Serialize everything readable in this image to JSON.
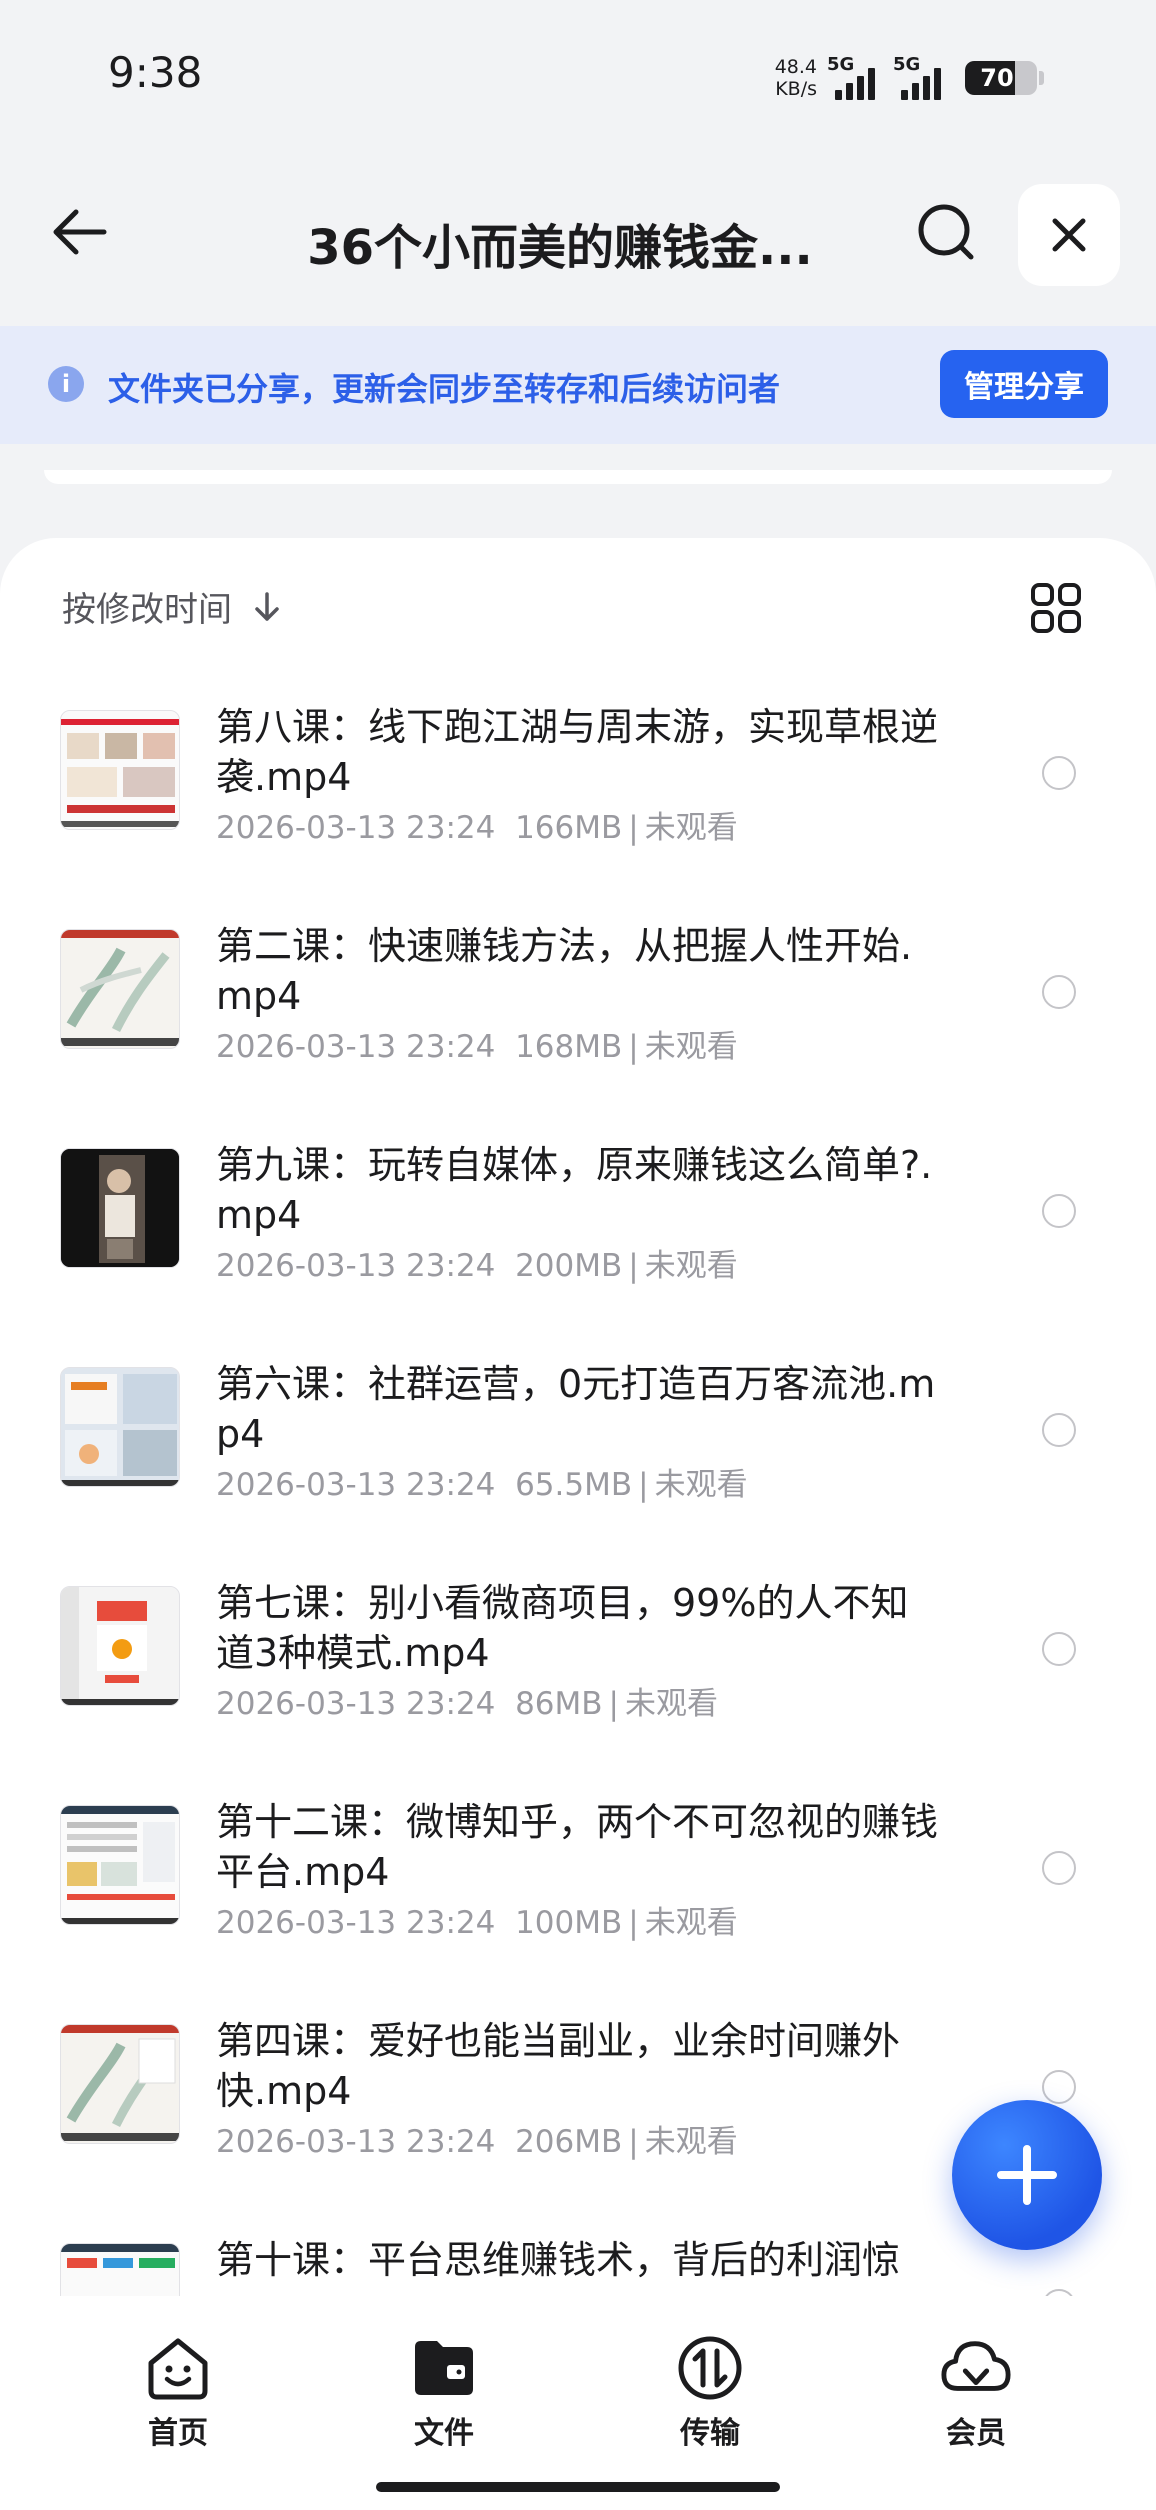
{
  "status_bar": {
    "time": "9:38",
    "net_speed_value": "48.4",
    "net_speed_unit": "KB/s",
    "signal_1_label": "5G",
    "signal_2_label": "5G",
    "battery_level": "70",
    "battery_percent": 70
  },
  "header": {
    "title": "36个小而美的赚钱金...",
    "back_icon": "arrow-left-icon",
    "search_icon": "search-icon",
    "close_icon": "close-icon"
  },
  "share_banner": {
    "text": "文件夹已分享，更新会同步至转存和后续访问者",
    "button_label": "管理分享",
    "info_icon": "info-icon",
    "info_glyph": "i"
  },
  "sort": {
    "label": "按修改时间",
    "direction_icon": "arrow-down-icon",
    "view_icon": "grid-view-icon"
  },
  "files": [
    {
      "name": "第八课：线下跑江湖与周末游，实现草根逆袭.mp4",
      "date": "2026-03-13 23:24",
      "size": "166MB",
      "status": "未观看"
    },
    {
      "name": "第二课：快速赚钱方法，从把握人性开始.mp4",
      "date": "2026-03-13 23:24",
      "size": "168MB",
      "status": "未观看"
    },
    {
      "name": "第九课：玩转自媒体，原来赚钱这么简单?.mp4",
      "date": "2026-03-13 23:24",
      "size": "200MB",
      "status": "未观看"
    },
    {
      "name": "第六课：社群运营，0元打造百万客流池.mp4",
      "date": "2026-03-13 23:24",
      "size": "65.5MB",
      "status": "未观看"
    },
    {
      "name": "第七课：别小看微商项目，99%的人不知道3种模式.mp4",
      "date": "2026-03-13 23:24",
      "size": "86MB",
      "status": "未观看"
    },
    {
      "name": "第十二课：微博知乎，两个不可忽视的赚钱平台.mp4",
      "date": "2026-03-13 23:24",
      "size": "100MB",
      "status": "未观看"
    },
    {
      "name": "第四课：爱好也能当副业，业余时间赚外快.mp4",
      "date": "2026-03-13 23:24",
      "size": "206MB",
      "status": "未观看"
    },
    {
      "name": "第十课：平台思维赚钱术，背后的利润惊",
      "date": "",
      "size": "",
      "status": ""
    }
  ],
  "fab": {
    "icon": "plus-icon"
  },
  "bottom_nav": [
    {
      "label": "首页",
      "icon": "home-face-icon"
    },
    {
      "label": "文件",
      "icon": "folder-icon"
    },
    {
      "label": "传输",
      "icon": "transfer-icon"
    },
    {
      "label": "会员",
      "icon": "cloud-vip-icon"
    }
  ],
  "colors": {
    "accent": "#2663f0",
    "banner_bg": "#e6ebfa",
    "banner_text": "#2c5fe8",
    "meta_text": "#9a9aa0"
  }
}
